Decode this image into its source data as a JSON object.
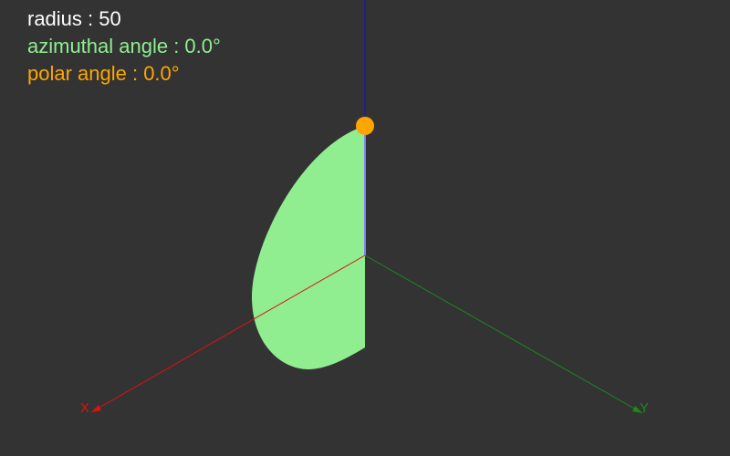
{
  "readouts": {
    "radius": {
      "label": "radius",
      "value": "50",
      "text": "radius : 50",
      "color": "#ffffff"
    },
    "azimuthal": {
      "label": "azimuthal angle",
      "value": "0.0°",
      "text": "azimuthal angle : 0.0°",
      "color": "#90ee90"
    },
    "polar": {
      "label": "polar angle",
      "value": "0.0°",
      "text": "polar angle : 0.0°",
      "color": "#ffa500"
    }
  },
  "axes": {
    "x": {
      "label": "X",
      "color": "#e01010"
    },
    "y": {
      "label": "Y",
      "color": "#1a8a1a"
    },
    "z": {
      "color": "#1b1bb0"
    }
  },
  "colors": {
    "background": "#333333",
    "sector_fill": "#90ee90",
    "handle": "#ffa500",
    "radius_line": "#8080ff"
  }
}
